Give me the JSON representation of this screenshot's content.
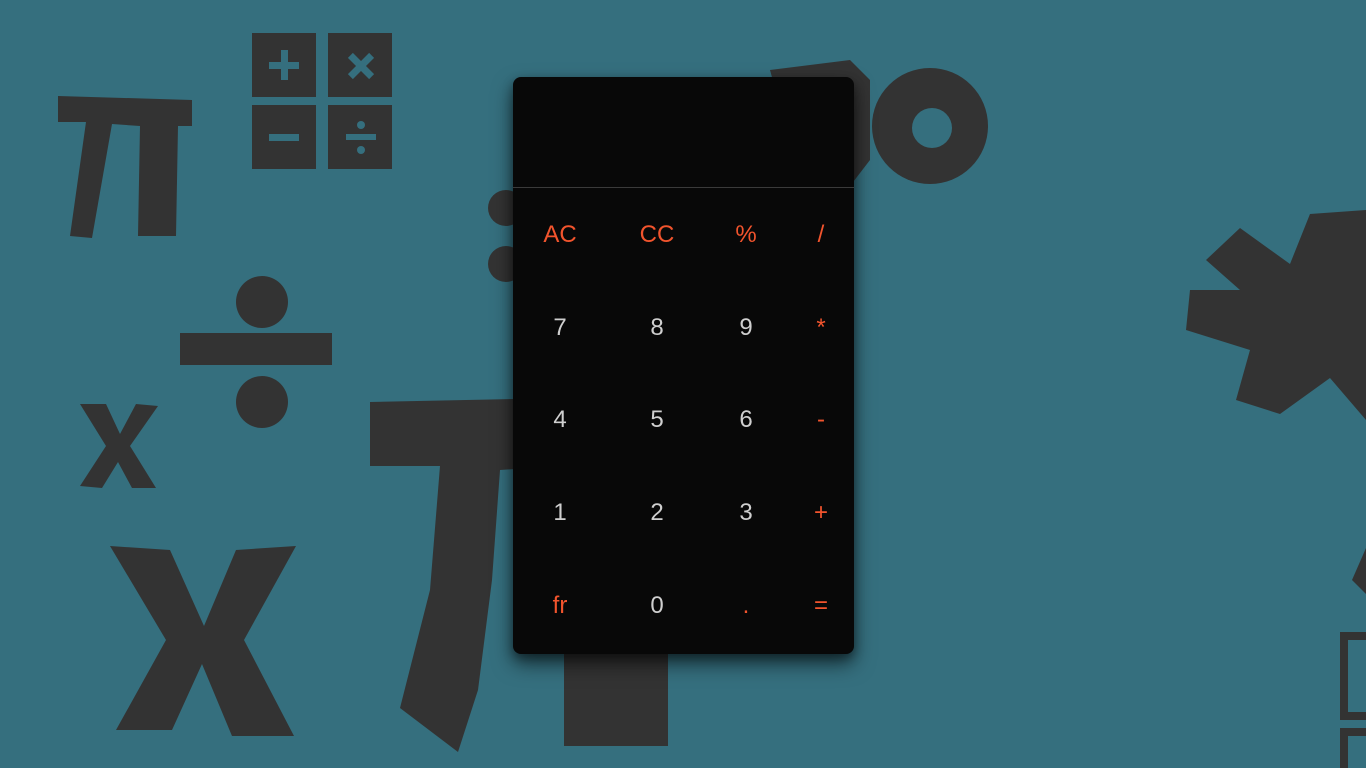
{
  "colors": {
    "background": "#356f7e",
    "doodle": "#333333",
    "calculator_body": "#080808",
    "operator_text": "#f2542d",
    "digit_text": "#cfcfcf"
  },
  "background_doodles": [
    "pi-icon",
    "plus-minus-times-divide-grid-icon",
    "divide-icon",
    "times-icon",
    "asterisk-icon"
  ],
  "calculator": {
    "display_value": "",
    "keys": [
      {
        "label": "AC",
        "kind": "op",
        "name": "ac-button"
      },
      {
        "label": "CC",
        "kind": "op",
        "name": "cc-button"
      },
      {
        "label": "%",
        "kind": "op",
        "name": "percent-button"
      },
      {
        "label": "/",
        "kind": "op",
        "name": "divide-button"
      },
      {
        "label": "7",
        "kind": "num",
        "name": "digit-7-button"
      },
      {
        "label": "8",
        "kind": "num",
        "name": "digit-8-button"
      },
      {
        "label": "9",
        "kind": "num",
        "name": "digit-9-button"
      },
      {
        "label": "*",
        "kind": "op",
        "name": "multiply-button"
      },
      {
        "label": "4",
        "kind": "num",
        "name": "digit-4-button"
      },
      {
        "label": "5",
        "kind": "num",
        "name": "digit-5-button"
      },
      {
        "label": "6",
        "kind": "num",
        "name": "digit-6-button"
      },
      {
        "label": "-",
        "kind": "op",
        "name": "subtract-button"
      },
      {
        "label": "1",
        "kind": "num",
        "name": "digit-1-button"
      },
      {
        "label": "2",
        "kind": "num",
        "name": "digit-2-button"
      },
      {
        "label": "3",
        "kind": "num",
        "name": "digit-3-button"
      },
      {
        "label": "+",
        "kind": "op",
        "name": "add-button"
      },
      {
        "label": "fr",
        "kind": "op",
        "name": "fraction-button"
      },
      {
        "label": "0",
        "kind": "num",
        "name": "digit-0-button"
      },
      {
        "label": ".",
        "kind": "op",
        "name": "decimal-button"
      },
      {
        "label": "=",
        "kind": "op",
        "name": "equals-button"
      }
    ]
  }
}
